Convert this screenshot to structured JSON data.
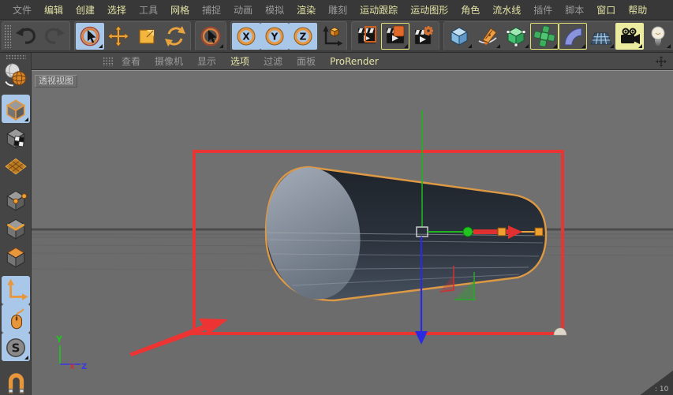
{
  "menubar": {
    "items": [
      {
        "label": "文件",
        "highlighted": false
      },
      {
        "label": "编辑",
        "highlighted": true
      },
      {
        "label": "创建",
        "highlighted": true
      },
      {
        "label": "选择",
        "highlighted": true
      },
      {
        "label": "工具",
        "highlighted": false
      },
      {
        "label": "网格",
        "highlighted": true
      },
      {
        "label": "捕捉",
        "highlighted": false
      },
      {
        "label": "动画",
        "highlighted": false
      },
      {
        "label": "模拟",
        "highlighted": false
      },
      {
        "label": "渲染",
        "highlighted": true
      },
      {
        "label": "雕刻",
        "highlighted": false
      },
      {
        "label": "运动跟踪",
        "highlighted": true
      },
      {
        "label": "运动图形",
        "highlighted": true
      },
      {
        "label": "角色",
        "highlighted": true
      },
      {
        "label": "流水线",
        "highlighted": true
      },
      {
        "label": "插件",
        "highlighted": false
      },
      {
        "label": "脚本",
        "highlighted": false
      },
      {
        "label": "窗口",
        "highlighted": true
      },
      {
        "label": "帮助",
        "highlighted": true
      }
    ]
  },
  "toolbar": {
    "axis_buttons": {
      "x": "X",
      "y": "Y",
      "z": "Z"
    },
    "buttons": [
      "undo",
      "redo",
      "live-selection",
      "move",
      "scale",
      "rotate",
      "selection",
      "lock-x",
      "lock-y",
      "lock-z",
      "coordinate-system",
      "render-view",
      "render-to-picture-viewer",
      "render-settings",
      "add-primitive",
      "add-spline",
      "add-generator",
      "add-mograph",
      "add-deformer",
      "add-environment",
      "add-camera",
      "add-light"
    ]
  },
  "viewport_menu": {
    "items": [
      {
        "label": "查看",
        "highlighted": false
      },
      {
        "label": "摄像机",
        "highlighted": false
      },
      {
        "label": "显示",
        "highlighted": false
      },
      {
        "label": "选项",
        "highlighted": true
      },
      {
        "label": "过滤",
        "highlighted": false
      },
      {
        "label": "面板",
        "highlighted": false
      },
      {
        "label": "ProRender",
        "highlighted": true
      }
    ]
  },
  "sidebar": {
    "items": [
      "make-editable",
      "model-mode",
      "texture-mode",
      "workplane-mode",
      "points-mode",
      "edges-mode",
      "polygons-mode",
      "enable-axis",
      "viewport-tweak",
      "snap-settings",
      "magnet-snap"
    ],
    "snap_letter": "S"
  },
  "viewport": {
    "label": "透视视图",
    "axis_labels": {
      "x": "X",
      "y": "Y",
      "z": "Z"
    },
    "corner_badge": ": 10"
  },
  "colors": {
    "accent_orange": "#e8a33d",
    "selection_blue": "#a9c7e8",
    "highlight_yellow": "#dede72",
    "annotation_red": "#ee3333",
    "menu_highlight_text": "#e3e3a6",
    "menu_normal_text": "#9a9a9a",
    "object_outline_orange": "#dd9944"
  }
}
